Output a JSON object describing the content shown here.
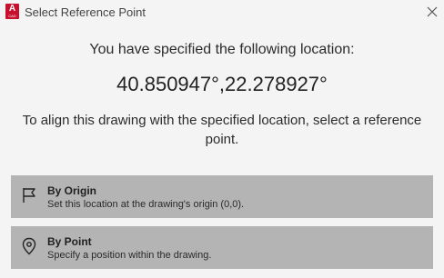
{
  "window": {
    "title": "Select Reference Point",
    "app_icon_letter": "A",
    "app_icon_sub": "CAD"
  },
  "message": {
    "specified": "You have specified the following location:",
    "coordinates": "40.850947°,22.278927°",
    "instruction": "To align this drawing with the specified location, select a reference point."
  },
  "options": [
    {
      "title": "By Origin",
      "description": "Set this location at the drawing's origin (0,0).",
      "icon": "flag-icon"
    },
    {
      "title": "By Point",
      "description": "Specify a position within the drawing.",
      "icon": "map-pin-icon"
    }
  ],
  "colors": {
    "background": "#f4f4f4",
    "option_background": "#b4b4b4",
    "brand": "#c8102e"
  }
}
